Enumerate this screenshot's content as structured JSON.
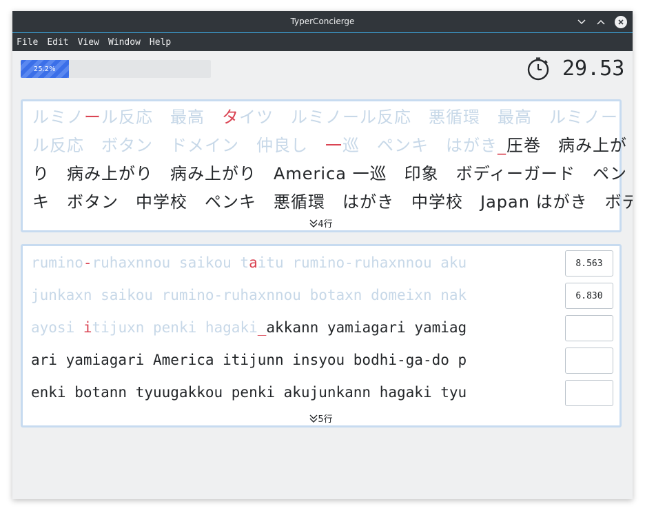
{
  "window": {
    "title": "TyperConcierge"
  },
  "menu": [
    "File",
    "Edit",
    "View",
    "Window",
    "Help"
  ],
  "progress": {
    "value": 0.252,
    "label": "25.2%"
  },
  "timer": {
    "value": "29.53"
  },
  "japanese": {
    "lines": [
      [
        {
          "t": "ルミノ",
          "s": "done"
        },
        {
          "t": "ー",
          "s": "err"
        },
        {
          "t": "ル反応　最高　",
          "s": "done"
        },
        {
          "t": "タ",
          "s": "err"
        },
        {
          "t": "イツ　ルミノール反応　悪循環　最高　ルミノー",
          "s": "done"
        }
      ],
      [
        {
          "t": "ル反応　ボタン　ドメイン　仲良し　",
          "s": "done"
        },
        {
          "t": "一",
          "s": "err"
        },
        {
          "t": "巡　ペンキ　はがき",
          "s": "done"
        },
        {
          "t": "_",
          "s": "cursor"
        },
        {
          "t": "圧巻　病み上が",
          "s": "todo"
        }
      ],
      [
        {
          "t": "り　病み上がり　病み上がり　America 一巡　印象　ボディーガード　ペン",
          "s": "todo"
        }
      ],
      [
        {
          "t": "キ　ボタン　中学校　ペンキ　悪循環　はがき　中学校　Japan はがき　ボデ",
          "s": "todo"
        }
      ]
    ],
    "more_label": "4行"
  },
  "romaji": {
    "lines": [
      [
        {
          "t": "rumino",
          "s": "done"
        },
        {
          "t": "-",
          "s": "err"
        },
        {
          "t": "ruhaxnnou saikou t",
          "s": "done"
        },
        {
          "t": "a",
          "s": "err"
        },
        {
          "t": "itu rumino-ruhaxnnou aku",
          "s": "done"
        }
      ],
      [
        {
          "t": "junkaxn saikou rumino-ruhaxnnou botaxn domeixn nak",
          "s": "done"
        }
      ],
      [
        {
          "t": "ayosi ",
          "s": "done"
        },
        {
          "t": "i",
          "s": "err"
        },
        {
          "t": "tijuxn penki hagaki",
          "s": "done"
        },
        {
          "t": "_",
          "s": "cursor"
        },
        {
          "t": "akkann yamiagari yamiag",
          "s": "todo"
        }
      ],
      [
        {
          "t": "ari yamiagari America itijunn insyou bodhi-ga-do p",
          "s": "todo"
        }
      ],
      [
        {
          "t": "enki botann tyuugakkou penki akujunkann hagaki tyu",
          "s": "todo"
        }
      ]
    ],
    "times": [
      "8.563",
      "6.830",
      "",
      "",
      ""
    ],
    "more_label": "5行"
  },
  "colors": {
    "accent": "#3daee9",
    "error": "#da4453",
    "done": "#c7d8e8",
    "progress": "#3b6fe8"
  },
  "icons": {
    "timer": "stopwatch-icon",
    "expand": "double-chevron-down-icon"
  }
}
